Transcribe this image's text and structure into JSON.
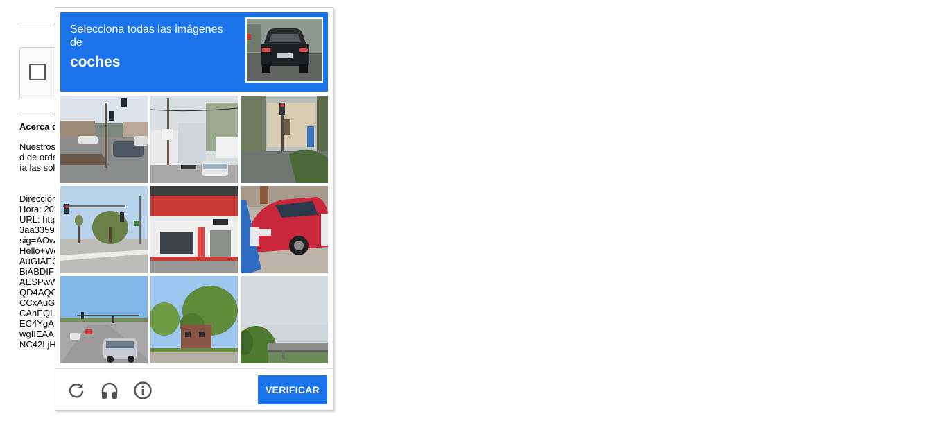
{
  "background": {
    "about_title": "Acerca d",
    "paragraph_lines": [
      "Nuestros",
      "d de orde",
      "ía las sol"
    ],
    "details_lines": [
      "Direcciór",
      "Hora: 202",
      "URL: http",
      "3aa3359",
      "sig=AOw",
      "Hello+Wo",
      "AuGIAEC",
      "BiABDIF",
      "AESPwW",
      "QD4AQC",
      "CCxAuG",
      "CAhEQL",
      "EC4YgA",
      "wgIIEAA",
      "NC42LjH"
    ]
  },
  "challenge": {
    "instruction": "Selecciona todas las imágenes de",
    "target": "coches",
    "accent_color": "#1a73e8",
    "sample_image": "car-rear-view",
    "tiles": [
      {
        "scene": "street-corner-traffic-light-cars"
      },
      {
        "scene": "street-houses-white-car"
      },
      {
        "scene": "traffic-light-trees-building"
      },
      {
        "scene": "highway-traffic-lights-palms"
      },
      {
        "scene": "red-white-storefront"
      },
      {
        "scene": "red-car-traffic-cone"
      },
      {
        "scene": "road-with-cars-suv"
      },
      {
        "scene": "trees-apartment-building"
      },
      {
        "scene": "sky-overpass-trees"
      }
    ],
    "footer": {
      "reload_icon": "reload-icon",
      "audio_icon": "headphones-icon",
      "info_icon": "info-icon",
      "verify_label": "VERIFICAR"
    }
  }
}
